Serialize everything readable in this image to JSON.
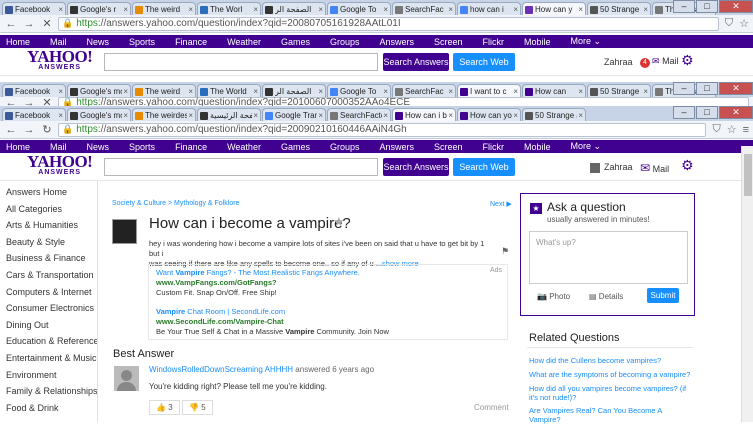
{
  "tab_strips": [
    {
      "tabs": [
        {
          "label": "Facebook",
          "color": "#3b5998"
        },
        {
          "label": "Google's r",
          "color": "#333"
        },
        {
          "label": "The weird",
          "color": "#e68a00"
        },
        {
          "label": "The Worl",
          "color": "#2a6ebb"
        },
        {
          "label": "الصفحة الر",
          "color": "#333"
        },
        {
          "label": "Google To",
          "color": "#4285f4"
        },
        {
          "label": "SearchFac",
          "color": "#777"
        },
        {
          "label": "how can i",
          "color": "#4285f4"
        },
        {
          "label": "How can y",
          "color": "#6b2fb3",
          "active": true
        },
        {
          "label": "50 Strange",
          "color": "#555"
        },
        {
          "label": "The Most",
          "color": "#777"
        }
      ]
    },
    {
      "tabs": [
        {
          "label": "Facebook",
          "color": "#3b5998"
        },
        {
          "label": "Google's mos",
          "color": "#333"
        },
        {
          "label": "The weird",
          "color": "#e68a00"
        },
        {
          "label": "The World",
          "color": "#2a6ebb"
        },
        {
          "label": "الصفحة الر",
          "color": "#333"
        },
        {
          "label": "Google To",
          "color": "#4285f4"
        },
        {
          "label": "SearchFac",
          "color": "#777"
        },
        {
          "label": "I want to c",
          "color": "#400090",
          "active": true
        },
        {
          "label": "How can",
          "color": "#400090"
        },
        {
          "label": "50 Strange",
          "color": "#555"
        },
        {
          "label": "The Most",
          "color": "#777"
        }
      ]
    },
    {
      "tabs": [
        {
          "label": "Facebook",
          "color": "#3b5998"
        },
        {
          "label": "Google's most",
          "color": "#333"
        },
        {
          "label": "The weirdest n",
          "color": "#e68a00"
        },
        {
          "label": "الصفحة الرئيسية",
          "color": "#333"
        },
        {
          "label": "Google Transl",
          "color": "#4285f4"
        },
        {
          "label": "SearchFactory",
          "color": "#777"
        },
        {
          "label": "How can i be",
          "color": "#400090",
          "active": true
        },
        {
          "label": "How can you li",
          "color": "#400090"
        },
        {
          "label": "50 Strange an",
          "color": "#555"
        }
      ]
    }
  ],
  "urls": [
    "https://answers.yahoo.com/question/index?qid=20080705161928AAtL01I",
    "https://answers.yahoo.com/question/index?qid=20100607000352AAo4ECE",
    "https://answers.yahoo.com/question/index?qid=20090210160446AAiN4Gh"
  ],
  "url_scheme": "https",
  "nav": [
    "Home",
    "Mail",
    "News",
    "Sports",
    "Finance",
    "Weather",
    "Games",
    "Groups",
    "Answers",
    "Screen",
    "Flickr",
    "Mobile",
    "More ⌄"
  ],
  "header": {
    "logo": "YAHOO!",
    "logo_sub": "ANSWERS",
    "search_answers": "Search Answers",
    "search_web": "Search Web",
    "user": "Zahraa",
    "mail": "Mail",
    "mail_badge": "4"
  },
  "sidebar": [
    "Answers Home",
    "All Categories",
    "Arts & Humanities",
    "Beauty & Style",
    "Business & Finance",
    "Cars & Transportation",
    "Computers & Internet",
    "Consumer Electronics",
    "Dining Out",
    "Education & Reference",
    "Entertainment & Music",
    "Environment",
    "Family & Relationships",
    "Food & Drink"
  ],
  "question": {
    "breadcrumb": "Society & Culture > Mythology & Folklore",
    "next": "Next ▶",
    "title": "How can i become a vampire?",
    "body_line1": "hey i was wondering how i become a vampire lots of sites i've been on said that u have to get bit by 1 but i",
    "body_line2": "was seeing if there are like any spells to become one.. so if any of u ...",
    "show_more": "show more"
  },
  "ads": {
    "label": "Ads",
    "ad1": {
      "title_prefix": "Want ",
      "title_bold": "Vampire",
      "title_suffix": " Fangs? - The Most Realistic Fangs Anywhere.",
      "url": "www.VampFangs.com/GotFangs?",
      "desc": "Custom Fit. Snap On/Off. Free Ship!"
    },
    "ad2": {
      "title_bold": "Vampire",
      "title_suffix": " Chat Room | SecondLife.com",
      "url": "www.SecondLife.com/Vampire-Chat",
      "desc_prefix": "Be Your True Self & Chat in a Massive ",
      "desc_bold": "Vampire",
      "desc_suffix": " Community. Join Now"
    }
  },
  "best_answer": {
    "heading": "Best Answer",
    "author": "WindowsRolledDownScreaming AHHHH",
    "meta": "answered 6 years ago",
    "text": "You're kidding right? Please tell me you're kidding.",
    "up_votes": "3",
    "down_votes": "5",
    "comment": "Comment"
  },
  "ask": {
    "title": "Ask a question",
    "subtitle": "usually answered in minutes!",
    "placeholder": "What's up?",
    "photo": "Photo",
    "details": "Details",
    "submit": "Submit"
  },
  "related": {
    "title": "Related Questions",
    "items": [
      "How did the Cullens become vampires?",
      "What are the symptoms of becoming a vampire?",
      "How did all you vampires become vampires? (if it's not rude!)?",
      "Are Vampires Real? Can You Become A Vampire?"
    ]
  }
}
